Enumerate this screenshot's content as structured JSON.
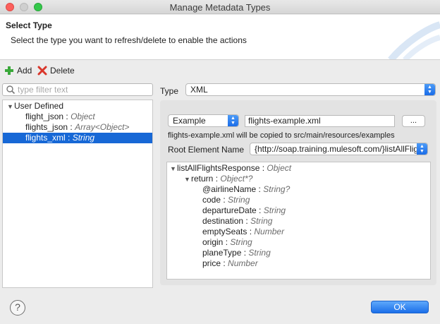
{
  "window": {
    "title": "Manage Metadata Types"
  },
  "header": {
    "title": "Select Type",
    "description": "Select the type you want to refresh/delete to enable the actions"
  },
  "toolbar": {
    "add_label": "Add",
    "delete_label": "Delete"
  },
  "filter": {
    "placeholder": "type filter text",
    "value": ""
  },
  "tree": {
    "group_label": "User Defined",
    "items": [
      {
        "name": "flight_json",
        "type": "Object"
      },
      {
        "name": "flights_json",
        "type": "Array<Object>"
      },
      {
        "name": "flights_xml",
        "type": "String",
        "selected": true
      }
    ]
  },
  "type_selector": {
    "label": "Type",
    "value": "XML"
  },
  "example": {
    "mode_value": "Example",
    "file_value": "flights-example.xml",
    "browse_label": "...",
    "note": "flights-example.xml will be copied to src/main/resources/examples"
  },
  "root_element": {
    "label": "Root Element Name",
    "value": "{http://soap.training.mulesoft.com/}listAllFlightsResponse"
  },
  "structure": [
    {
      "name": "listAllFlightsResponse",
      "type": "Object",
      "level": 0,
      "expandable": true
    },
    {
      "name": "return",
      "type": "Object*?",
      "level": 1,
      "expandable": true
    },
    {
      "name": "@airlineName",
      "type": "String?",
      "level": 2
    },
    {
      "name": "code",
      "type": "String",
      "level": 2
    },
    {
      "name": "departureDate",
      "type": "String",
      "level": 2
    },
    {
      "name": "destination",
      "type": "String",
      "level": 2
    },
    {
      "name": "emptySeats",
      "type": "Number",
      "level": 2
    },
    {
      "name": "origin",
      "type": "String",
      "level": 2
    },
    {
      "name": "planeType",
      "type": "String",
      "level": 2
    },
    {
      "name": "price",
      "type": "Number",
      "level": 2
    }
  ],
  "footer": {
    "help_label": "?",
    "ok_label": "OK"
  },
  "colors": {
    "selection": "#1768d6",
    "accent_button": "#1b6fe9",
    "add_icon": "#3aa83a",
    "delete_icon": "#d9362b"
  },
  "icons": [
    "add-icon",
    "delete-icon",
    "search-icon",
    "help-icon"
  ]
}
